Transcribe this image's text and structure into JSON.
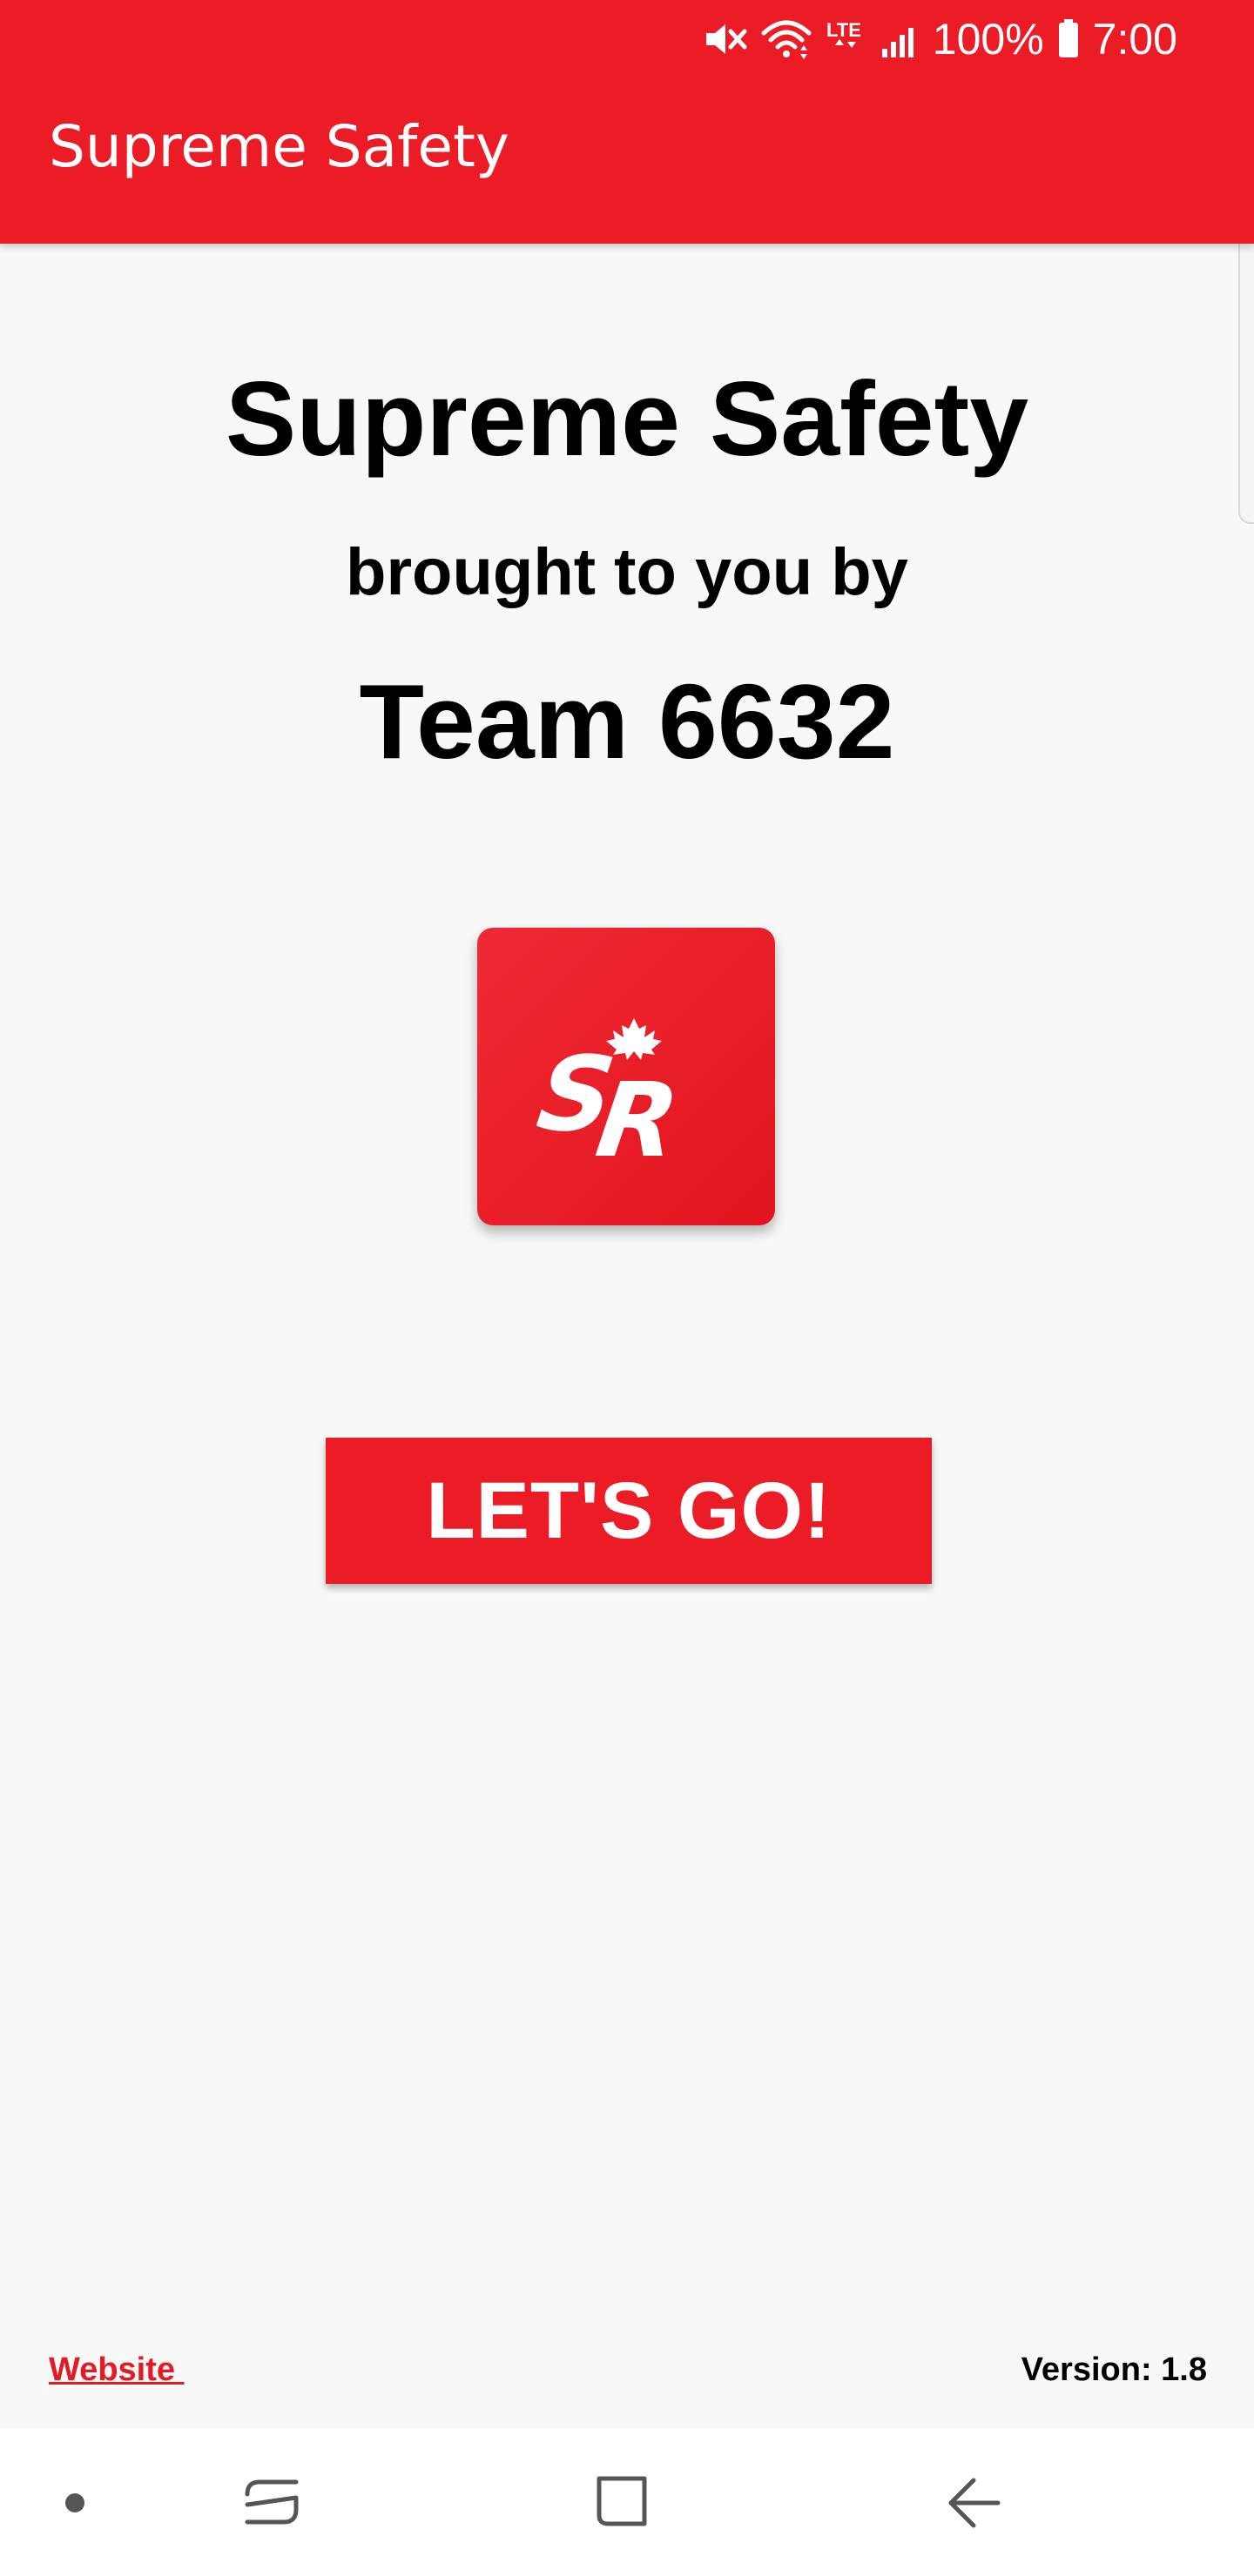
{
  "status_bar": {
    "battery": "100%",
    "time": "7:00",
    "network": "LTE",
    "icons": [
      "mute-icon",
      "wifi-icon",
      "lte-icon",
      "signal-icon",
      "battery-icon"
    ]
  },
  "app_bar": {
    "title": "Supreme Safety"
  },
  "main": {
    "app_name": "Supreme Safety",
    "tagline": "brought to you by",
    "team": "Team 6632",
    "logo_icon": "sr-logo-icon",
    "primary_button_label": "LET'S GO!"
  },
  "footer": {
    "website_label": "Website ",
    "version": "Version: 1.8"
  },
  "nav_bar": {
    "icons": [
      "dot-icon",
      "recents-icon",
      "home-icon",
      "back-icon"
    ]
  },
  "colors": {
    "primary": "#ec1c27",
    "background": "#f8f8f8",
    "link": "#e31b25",
    "text": "#000000"
  }
}
